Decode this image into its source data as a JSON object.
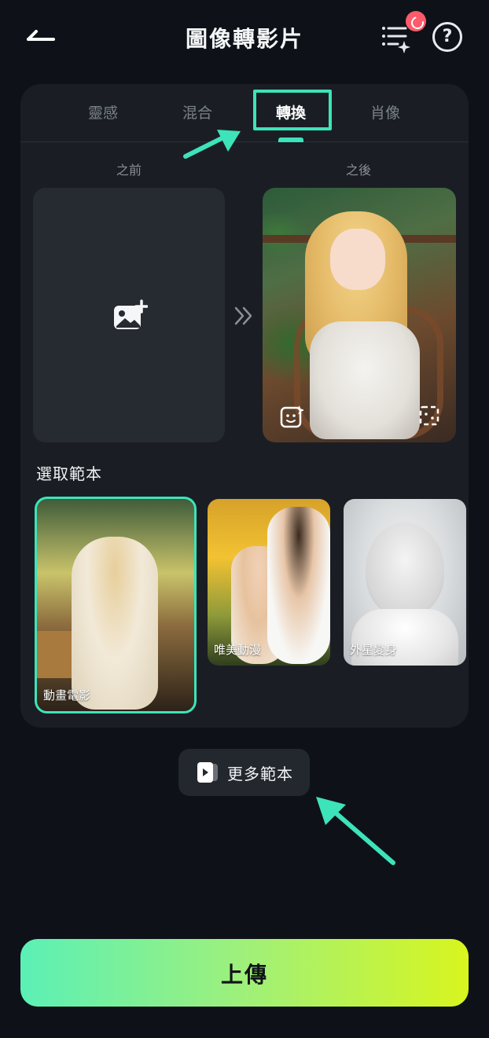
{
  "header": {
    "title": "圖像轉影片",
    "back_icon": "back-arrow-icon",
    "list_icon": "sparkle-list-icon",
    "help_label": "?",
    "accent": "#3de3b9"
  },
  "tabs": [
    {
      "label": "靈感",
      "active": false
    },
    {
      "label": "混合",
      "active": false
    },
    {
      "label": "轉換",
      "active": true
    },
    {
      "label": "肖像",
      "active": false
    }
  ],
  "compare": {
    "before_label": "之前",
    "after_label": "之後"
  },
  "templates": {
    "section_title": "選取範本",
    "items": [
      {
        "label": "動畫電影",
        "selected": true
      },
      {
        "label": "唯美動漫",
        "selected": false
      },
      {
        "label": "外星變身",
        "selected": false
      }
    ]
  },
  "more_button": {
    "label": "更多範本"
  },
  "upload_button": {
    "label": "上傳"
  }
}
